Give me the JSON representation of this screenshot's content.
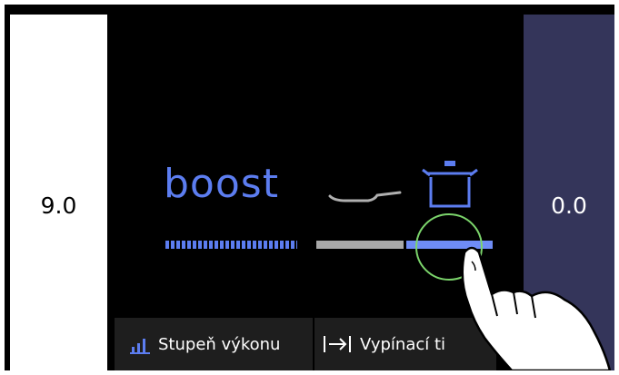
{
  "left_panel": {
    "value": "9.0"
  },
  "right_panel": {
    "value": "0.0"
  },
  "main": {
    "mode_label": "boost",
    "levels": {
      "boost_bar_fill": 1.0,
      "pan_bar_fill": 1.0,
      "pot_bar_fill": 1.0
    }
  },
  "tabs": [
    {
      "label": "Stupeň výkonu",
      "icon": "bars-icon"
    },
    {
      "label": "Vypínací ti",
      "icon": "arrow-to-line-icon"
    }
  ],
  "colors": {
    "accent": "#5c7df0",
    "right_panel_bg": "#34355a",
    "pan_bar": "#a8a8a8",
    "touch_ring": "#7bd46b"
  },
  "icons": [
    "pan-icon",
    "pot-icon",
    "hand-pointer-icon"
  ]
}
